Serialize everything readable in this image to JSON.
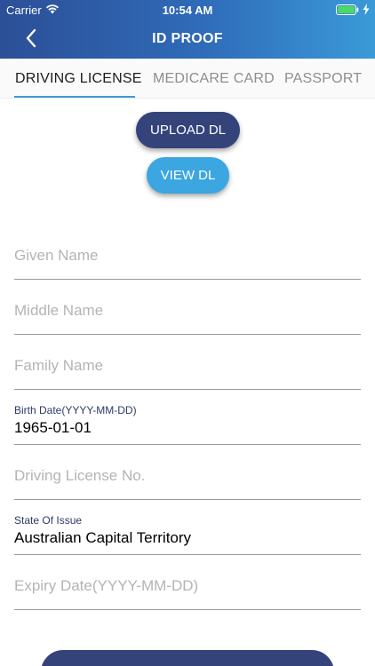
{
  "status_bar": {
    "carrier": "Carrier",
    "time": "10:54 AM"
  },
  "nav": {
    "title": "ID PROOF",
    "back_icon": "chevron-left-icon"
  },
  "tabs": [
    {
      "label": "DRIVING LICENSE",
      "active": true
    },
    {
      "label": "MEDICARE CARD",
      "active": false
    },
    {
      "label": "PASSPORT",
      "active": false
    }
  ],
  "actions": {
    "upload_label": "UPLOAD DL",
    "view_label": "VIEW DL"
  },
  "form": {
    "given_name": {
      "placeholder": "Given Name"
    },
    "middle_name": {
      "placeholder": "Middle Name"
    },
    "family_name": {
      "placeholder": "Family Name"
    },
    "birth_date": {
      "label": "Birth Date(YYYY-MM-DD)",
      "value": "1965-01-01"
    },
    "license_no": {
      "placeholder": "Driving License No."
    },
    "state_of_issue": {
      "label": "State Of Issue",
      "value": "Australian Capital Territory"
    },
    "expiry_date": {
      "placeholder": "Expiry Date(YYYY-MM-DD)"
    }
  },
  "colors": {
    "header_start": "#2c4f97",
    "header_end": "#3a9ad8",
    "primary_button": "#34437a",
    "secondary_button": "#3ba6e0",
    "tab_indicator": "#3e9ad6",
    "battery": "#4cd964"
  }
}
